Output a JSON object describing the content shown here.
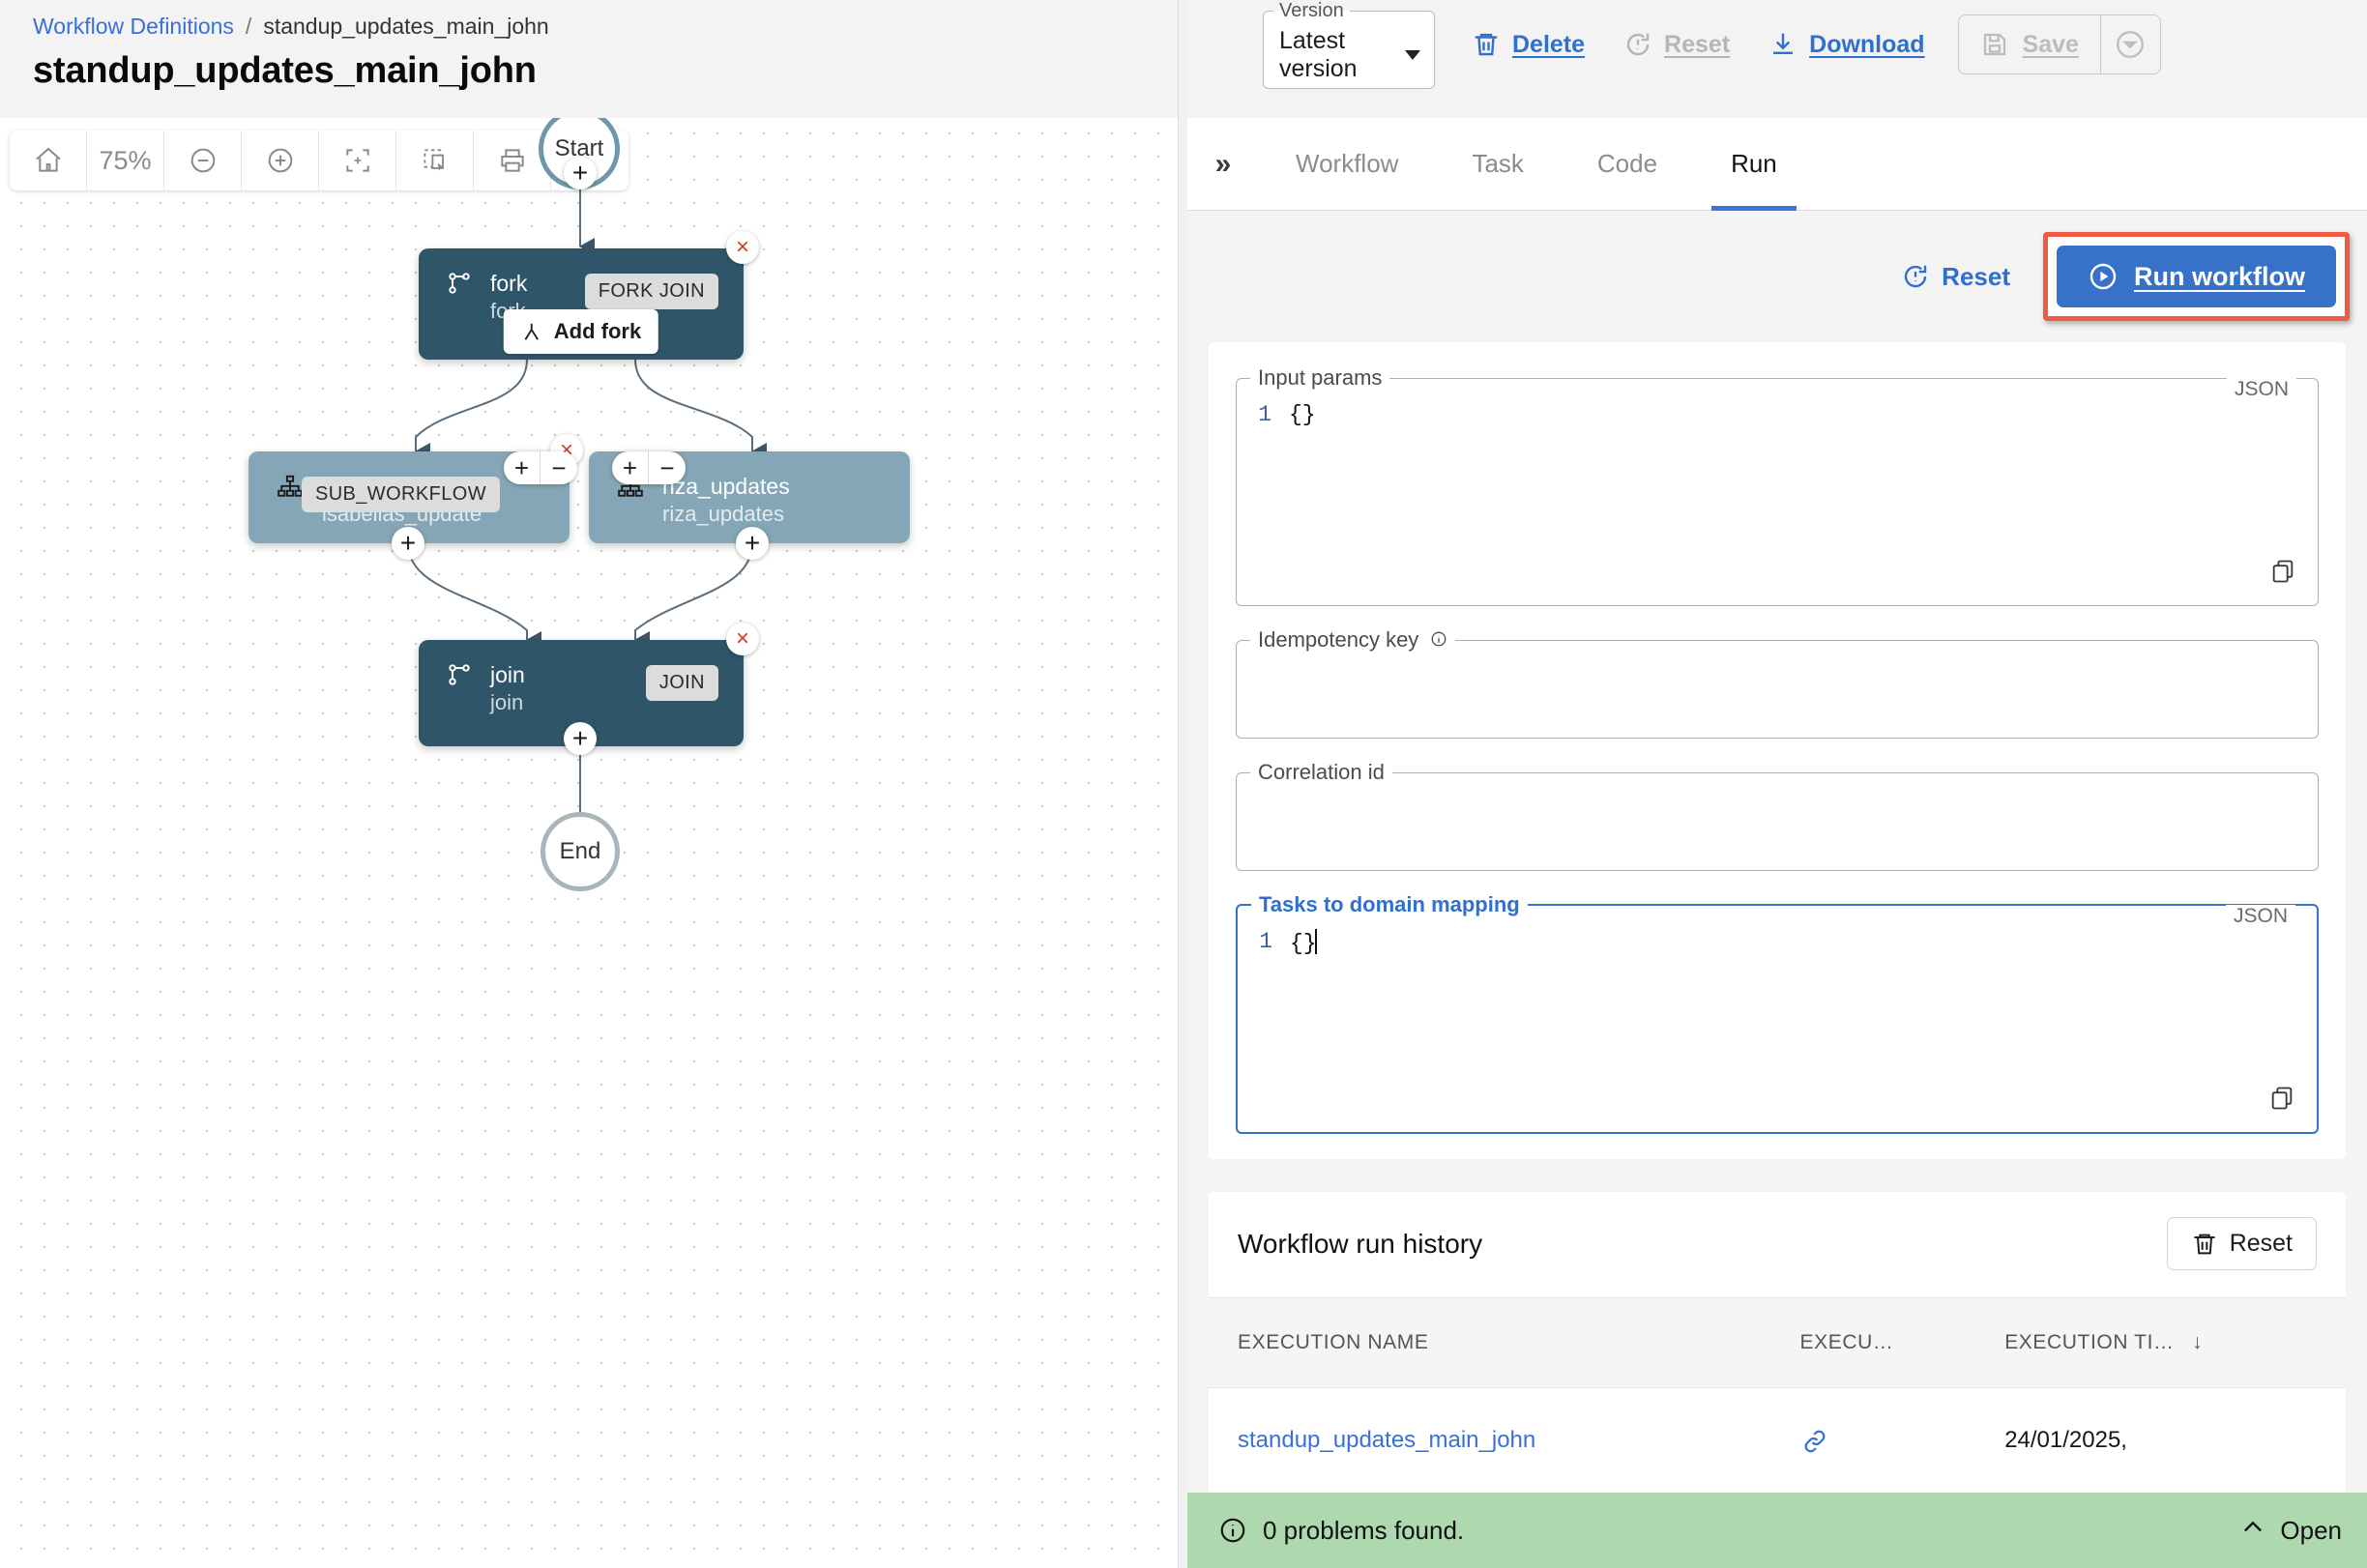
{
  "header": {
    "breadcrumb": {
      "root": "Workflow Definitions",
      "separator": "/",
      "current": "standup_updates_main_john"
    },
    "title": "standup_updates_main_john"
  },
  "toolbar": {
    "version": {
      "legend": "Version",
      "value": "Latest version"
    },
    "delete_label": "Delete",
    "reset_label": "Reset",
    "download_label": "Download",
    "save_label": "Save"
  },
  "canvas": {
    "zoom_level": "75%",
    "tools": [
      "home-icon",
      "zoom-level",
      "zoom-out-icon",
      "zoom-in-icon",
      "fit-screen-icon",
      "select-region-icon",
      "print-icon",
      "search-icon"
    ],
    "nodes": {
      "start": {
        "label": "Start"
      },
      "fork": {
        "title": "fork",
        "subtitle": "fork",
        "badge": "FORK JOIN",
        "action": "Add fork"
      },
      "branch_left": {
        "title": "isabellas_update",
        "subtitle": "isabellas_update",
        "badge": "SUB_WORKFLOW"
      },
      "branch_right": {
        "title": "riza_updates",
        "subtitle": "riza_updates",
        "badge": ""
      },
      "join": {
        "title": "join",
        "subtitle": "join",
        "badge": "JOIN"
      },
      "end": {
        "label": "End"
      }
    }
  },
  "panel": {
    "tabs": [
      {
        "label": "Workflow",
        "active": false
      },
      {
        "label": "Task",
        "active": false
      },
      {
        "label": "Code",
        "active": false
      },
      {
        "label": "Run",
        "active": true
      }
    ],
    "reset_label": "Reset",
    "run_label": "Run workflow",
    "fields": {
      "input_params": {
        "legend": "Input params",
        "tag": "JSON",
        "line_no": "1",
        "value": "{}"
      },
      "idempotency_key": {
        "legend": "Idempotency key",
        "value": ""
      },
      "correlation_id": {
        "legend": "Correlation id",
        "value": ""
      },
      "tasks_to_domain": {
        "legend": "Tasks to domain mapping",
        "tag": "JSON",
        "line_no": "1",
        "value": "{}"
      }
    },
    "history": {
      "title": "Workflow run history",
      "reset_label": "Reset",
      "columns": [
        "EXECUTION NAME",
        "EXECU…",
        "EXECUTION TI…"
      ],
      "rows": [
        {
          "name": "standup_updates_main_john",
          "link": "link-icon",
          "time": "24/01/2025,"
        }
      ]
    }
  },
  "statusbar": {
    "message": "0 problems found.",
    "open_label": "Open"
  },
  "colors": {
    "accent_blue": "#3771c8",
    "link_blue": "#3a6fd8",
    "highlight_red": "#ef5a43",
    "node_dark": "#2f5668",
    "node_light": "#85a6b6",
    "status_green": "#aed8ae"
  }
}
